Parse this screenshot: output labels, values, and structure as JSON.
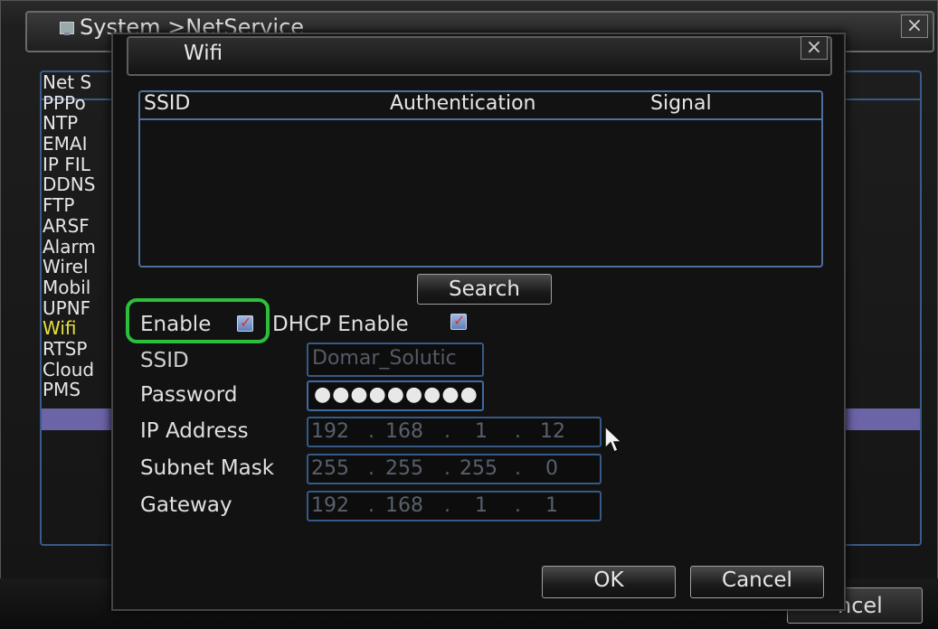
{
  "background_window": {
    "title": "System >NetService",
    "close_glyph": "×",
    "list_items": [
      "Net S",
      "PPPo",
      "NTP",
      "EMAI",
      "IP FIL",
      "DDNS",
      "FTP",
      "ARSF",
      "Alarm",
      "Wirel",
      "Mobil",
      "UPNF",
      "Wifi",
      "RTSP",
      "Cloud",
      "PMS"
    ],
    "selected_item": "Wifi",
    "partial_cancel_label": "ncel",
    "selection_color": "#6b64a6",
    "selected_text_color": "#e8e03a"
  },
  "dialog": {
    "title": "Wifi",
    "close_glyph": "×",
    "table": {
      "columns": [
        "SSID",
        "Authentication",
        "Signal"
      ],
      "rows": []
    },
    "search_label": "Search",
    "enable": {
      "label": "Enable",
      "checked": true
    },
    "dhcp_enable": {
      "label": "DHCP Enable",
      "checked": true
    },
    "fields": {
      "ssid": {
        "label": "SSID",
        "value": "Domar_Solutic"
      },
      "password": {
        "label": "Password",
        "value": "●●●●●●●●●"
      },
      "ip_address": {
        "label": "IP Address",
        "octets": [
          "192",
          "168",
          "1",
          "12"
        ]
      },
      "subnet_mask": {
        "label": "Subnet Mask",
        "octets": [
          "255",
          "255",
          "255",
          "0"
        ]
      },
      "gateway": {
        "label": "Gateway",
        "octets": [
          "192",
          "168",
          "1",
          "1"
        ]
      }
    },
    "ok_label": "OK",
    "cancel_label": "Cancel",
    "highlight_color": "#2bbf3c",
    "accent_border": "#4f6f9c"
  },
  "icons": {
    "title_icon": "monitor-icon",
    "cursor": "mouse-pointer-icon",
    "checkmark": "checkmark-icon"
  }
}
